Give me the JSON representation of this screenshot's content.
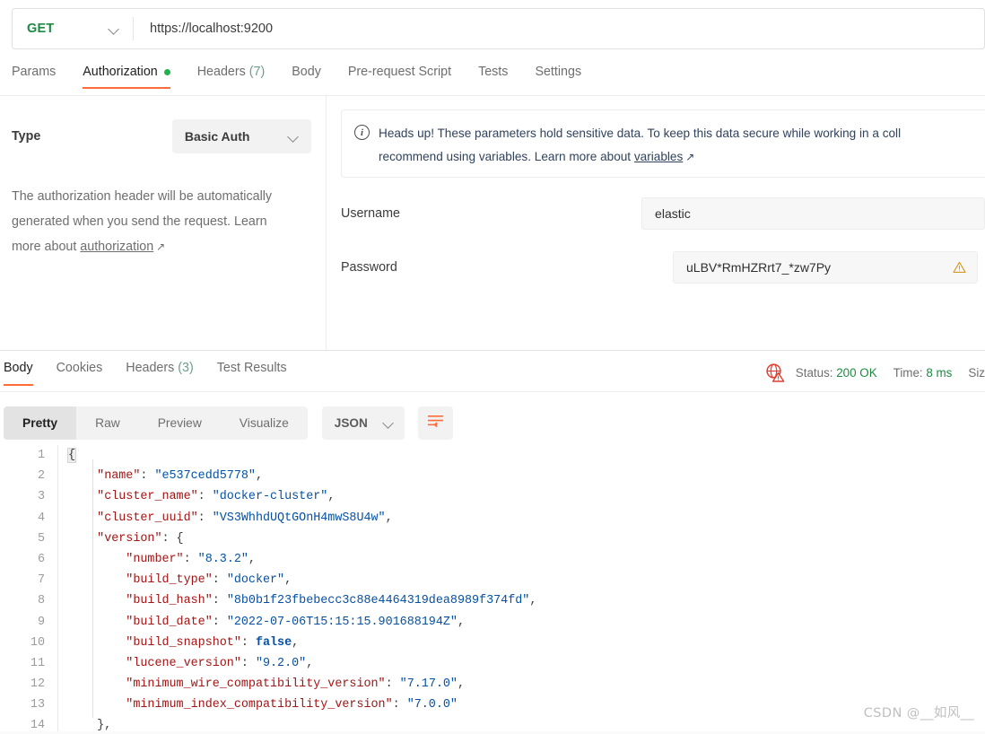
{
  "request_bar": {
    "method": "GET",
    "method_chevron_icon": "chevron-down-icon",
    "url": "https://localhost:9200"
  },
  "request_tabs": [
    {
      "label": "Params",
      "active": false,
      "dot": false,
      "count": ""
    },
    {
      "label": "Authorization",
      "active": true,
      "dot": true,
      "count": ""
    },
    {
      "label": "Headers",
      "active": false,
      "dot": false,
      "count": "(7)"
    },
    {
      "label": "Body",
      "active": false,
      "dot": false,
      "count": ""
    },
    {
      "label": "Pre-request Script",
      "active": false,
      "dot": false,
      "count": ""
    },
    {
      "label": "Tests",
      "active": false,
      "dot": false,
      "count": ""
    },
    {
      "label": "Settings",
      "active": false,
      "dot": false,
      "count": ""
    }
  ],
  "authorization": {
    "type_label": "Type",
    "type_value": "Basic Auth",
    "type_chevron_icon": "chevron-down-icon",
    "description_line1": "The authorization header will be automatically",
    "description_line2": "generated when you send the request. Learn",
    "description_line3_prefix": "more about ",
    "description_link": "authorization",
    "external_link_icon": "↗",
    "notice": {
      "icon": "info-icon",
      "line1": "Heads up! These parameters hold sensitive data. To keep this data secure while working in a coll",
      "line2_prefix": "recommend using variables. Learn more about ",
      "line2_link": "variables",
      "external_link_icon": "↗"
    },
    "username_label": "Username",
    "username_value": "elastic",
    "password_label": "Password",
    "password_value": "uLBV*RmHZRrt7_*zw7Py",
    "password_warning_icon": "warning-triangle-icon"
  },
  "response_tabs": [
    {
      "label": "Body",
      "active": true,
      "count": ""
    },
    {
      "label": "Cookies",
      "active": false,
      "count": ""
    },
    {
      "label": "Headers",
      "active": false,
      "count": "(3)"
    },
    {
      "label": "Test Results",
      "active": false,
      "count": ""
    }
  ],
  "response_meta": {
    "ssl_icon": "globe-warning-icon",
    "status_label": "Status:",
    "status_value": "200 OK",
    "time_label": "Time:",
    "time_value": "8 ms",
    "size_label": "Siz"
  },
  "response_toolbar": {
    "views": [
      {
        "label": "Pretty",
        "active": true
      },
      {
        "label": "Raw",
        "active": false
      },
      {
        "label": "Preview",
        "active": false
      },
      {
        "label": "Visualize",
        "active": false
      }
    ],
    "format": "JSON",
    "format_chevron_icon": "chevron-down-icon",
    "wrap_icon": "word-wrap-icon"
  },
  "code": {
    "lines": [
      {
        "n": "1",
        "tokens": [
          {
            "t": "{",
            "c": "brace-hl"
          }
        ]
      },
      {
        "n": "2",
        "tokens": [
          {
            "t": "    ",
            "c": "p"
          },
          {
            "t": "\"name\"",
            "c": "k"
          },
          {
            "t": ": ",
            "c": "p"
          },
          {
            "t": "\"e537cedd5778\"",
            "c": "s"
          },
          {
            "t": ",",
            "c": "p"
          }
        ]
      },
      {
        "n": "3",
        "tokens": [
          {
            "t": "    ",
            "c": "p"
          },
          {
            "t": "\"cluster_name\"",
            "c": "k"
          },
          {
            "t": ": ",
            "c": "p"
          },
          {
            "t": "\"docker-cluster\"",
            "c": "s"
          },
          {
            "t": ",",
            "c": "p"
          }
        ]
      },
      {
        "n": "4",
        "tokens": [
          {
            "t": "    ",
            "c": "p"
          },
          {
            "t": "\"cluster_uuid\"",
            "c": "k"
          },
          {
            "t": ": ",
            "c": "p"
          },
          {
            "t": "\"VS3WhhdUQtGOnH4mwS8U4w\"",
            "c": "s"
          },
          {
            "t": ",",
            "c": "p"
          }
        ]
      },
      {
        "n": "5",
        "tokens": [
          {
            "t": "    ",
            "c": "p"
          },
          {
            "t": "\"version\"",
            "c": "k"
          },
          {
            "t": ": {",
            "c": "p"
          }
        ]
      },
      {
        "n": "6",
        "tokens": [
          {
            "t": "        ",
            "c": "p"
          },
          {
            "t": "\"number\"",
            "c": "k"
          },
          {
            "t": ": ",
            "c": "p"
          },
          {
            "t": "\"8.3.2\"",
            "c": "s"
          },
          {
            "t": ",",
            "c": "p"
          }
        ]
      },
      {
        "n": "7",
        "tokens": [
          {
            "t": "        ",
            "c": "p"
          },
          {
            "t": "\"build_type\"",
            "c": "k"
          },
          {
            "t": ": ",
            "c": "p"
          },
          {
            "t": "\"docker\"",
            "c": "s"
          },
          {
            "t": ",",
            "c": "p"
          }
        ]
      },
      {
        "n": "8",
        "tokens": [
          {
            "t": "        ",
            "c": "p"
          },
          {
            "t": "\"build_hash\"",
            "c": "k"
          },
          {
            "t": ": ",
            "c": "p"
          },
          {
            "t": "\"8b0b1f23fbebecc3c88e4464319dea8989f374fd\"",
            "c": "s"
          },
          {
            "t": ",",
            "c": "p"
          }
        ]
      },
      {
        "n": "9",
        "tokens": [
          {
            "t": "        ",
            "c": "p"
          },
          {
            "t": "\"build_date\"",
            "c": "k"
          },
          {
            "t": ": ",
            "c": "p"
          },
          {
            "t": "\"2022-07-06T15:15:15.901688194Z\"",
            "c": "s"
          },
          {
            "t": ",",
            "c": "p"
          }
        ]
      },
      {
        "n": "10",
        "tokens": [
          {
            "t": "        ",
            "c": "p"
          },
          {
            "t": "\"build_snapshot\"",
            "c": "k"
          },
          {
            "t": ": ",
            "c": "p"
          },
          {
            "t": "false",
            "c": "b"
          },
          {
            "t": ",",
            "c": "p"
          }
        ]
      },
      {
        "n": "11",
        "tokens": [
          {
            "t": "        ",
            "c": "p"
          },
          {
            "t": "\"lucene_version\"",
            "c": "k"
          },
          {
            "t": ": ",
            "c": "p"
          },
          {
            "t": "\"9.2.0\"",
            "c": "s"
          },
          {
            "t": ",",
            "c": "p"
          }
        ]
      },
      {
        "n": "12",
        "tokens": [
          {
            "t": "        ",
            "c": "p"
          },
          {
            "t": "\"minimum_wire_compatibility_version\"",
            "c": "k"
          },
          {
            "t": ": ",
            "c": "p"
          },
          {
            "t": "\"7.17.0\"",
            "c": "s"
          },
          {
            "t": ",",
            "c": "p"
          }
        ]
      },
      {
        "n": "13",
        "tokens": [
          {
            "t": "        ",
            "c": "p"
          },
          {
            "t": "\"minimum_index_compatibility_version\"",
            "c": "k"
          },
          {
            "t": ": ",
            "c": "p"
          },
          {
            "t": "\"7.0.0\"",
            "c": "s"
          }
        ]
      },
      {
        "n": "14",
        "tokens": [
          {
            "t": "    },",
            "c": "p"
          }
        ]
      }
    ]
  },
  "watermark": "CSDN @__如风__",
  "colors": {
    "accent_orange": "#ff6c37",
    "method_green": "#1d8a42",
    "status_green": "#1d8a42",
    "dot_green": "#23b14d",
    "key_red": "#a31515",
    "string_blue": "#0451a5",
    "ssl_warn_red": "#e03e2f",
    "password_warn_amber": "#d79a1e"
  }
}
